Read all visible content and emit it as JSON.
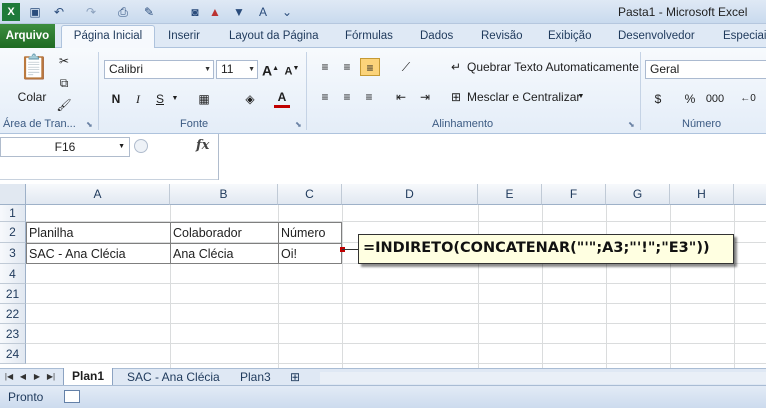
{
  "window": {
    "title": "Pasta1 - Microsoft Excel"
  },
  "tabs": [
    {
      "label": "Arquivo"
    },
    {
      "label": "Página Inicial"
    },
    {
      "label": "Inserir"
    },
    {
      "label": "Layout da Página"
    },
    {
      "label": "Fórmulas"
    },
    {
      "label": "Dados"
    },
    {
      "label": "Revisão"
    },
    {
      "label": "Exibição"
    },
    {
      "label": "Desenvolvedor"
    },
    {
      "label": "Especiais"
    }
  ],
  "ribbon": {
    "clipboard": {
      "paste_label": "Colar",
      "group_label": "Área de Tran..."
    },
    "font": {
      "font_name": "Calibri",
      "font_size": "11",
      "bold": "N",
      "italic": "I",
      "underline": "S",
      "group_label": "Fonte"
    },
    "alignment": {
      "wrap_label": "Quebrar Texto Automaticamente",
      "merge_label": "Mesclar e Centralizar",
      "group_label": "Alinhamento"
    },
    "number": {
      "format": "Geral",
      "percent": "%",
      "thousands": "000",
      "group_label": "Número"
    }
  },
  "formula_bar": {
    "name_box": "F16",
    "fx": "fx",
    "formula": ""
  },
  "grid": {
    "columns": [
      "A",
      "B",
      "C",
      "D",
      "E",
      "F",
      "G",
      "H"
    ],
    "rows": [
      "1",
      "2",
      "3",
      "4",
      "21",
      "22",
      "23",
      "24"
    ],
    "cells": {
      "A2": "Planilha",
      "B2": "Colaborador",
      "C2": "Número",
      "A3": "SAC - Ana Clécia",
      "B3": "Ana Clécia",
      "C3": "Oi!"
    },
    "callout": "=INDIRETO(CONCATENAR(\"'\";A3;\"'!\";\"E3\"))"
  },
  "sheets": [
    "Plan1",
    "SAC - Ana Clécia",
    "Plan3"
  ],
  "status": {
    "text": "Pronto"
  },
  "colors": {
    "file_tab": "#2a7a2e",
    "callout_bg": "#ffffe1",
    "accent_red": "#c00000"
  }
}
